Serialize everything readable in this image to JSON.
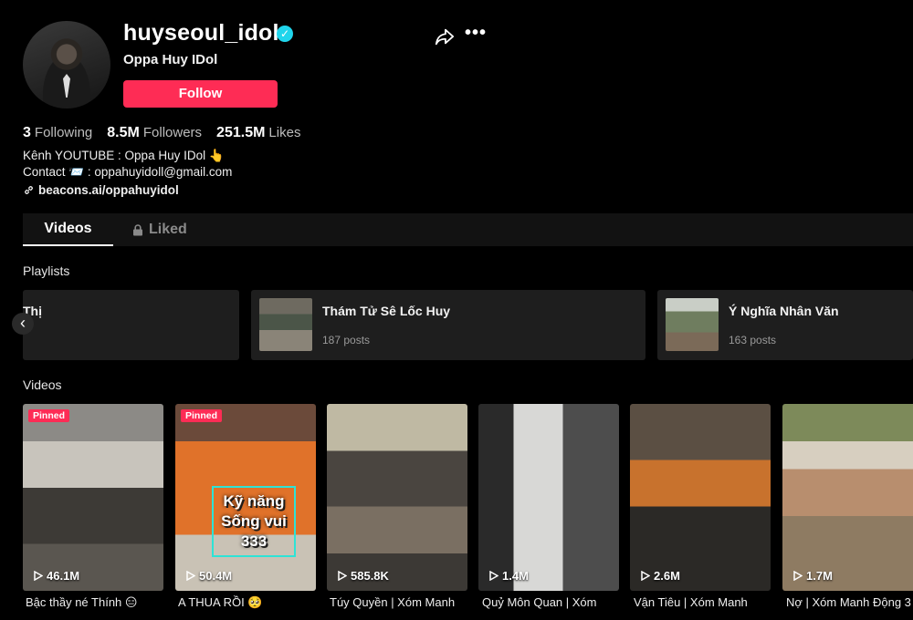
{
  "profile": {
    "username": "huyseoul_idol",
    "nickname": "Oppa Huy IDol",
    "follow_label": "Follow",
    "stats": {
      "following_count": "3",
      "following_label": "Following",
      "followers_count": "8.5M",
      "followers_label": "Followers",
      "likes_count": "251.5M",
      "likes_label": "Likes"
    },
    "bio_line1": "Kênh YOUTUBE : Oppa Huy IDol 👆",
    "bio_line2_prefix": "Contact",
    "bio_line2_emoji": "📨",
    "bio_line2_email": ": oppahuyidoll@gmail.com",
    "link": "beacons.ai/oppahuyidol"
  },
  "tabs": [
    {
      "label": "Videos",
      "active": true
    },
    {
      "label": "Liked",
      "active": false,
      "icon": "lock-icon"
    }
  ],
  "playlists_title": "Playlists",
  "playlists": [
    {
      "name": "Thị",
      "count": ""
    },
    {
      "name": "Thám Tử Sê Lốc Huy",
      "count": "187 posts"
    },
    {
      "name": "Ý Nghĩa Nhân Văn",
      "count": "163 posts"
    }
  ],
  "videos_title": "Videos",
  "videos": [
    {
      "views": "46.1M",
      "caption": "Bậc thầy né Thính 😑",
      "pinned": "Pinned"
    },
    {
      "views": "50.4M",
      "caption": "A THUA RỒI 🥺",
      "pinned": "Pinned",
      "overlay": "Kỹ năng Sống vui 333"
    },
    {
      "views": "585.8K",
      "caption": "Túy Quyền | Xóm Manh"
    },
    {
      "views": "1.4M",
      "caption": "Quỷ Môn Quan | Xóm"
    },
    {
      "views": "2.6M",
      "caption": "Vận Tiêu | Xóm Manh"
    },
    {
      "views": "1.7M",
      "caption": "Nợ | Xóm Manh Động 3"
    }
  ],
  "colors": {
    "accent": "#fe2c55",
    "verified": "#20d5ec",
    "background": "#000000"
  }
}
